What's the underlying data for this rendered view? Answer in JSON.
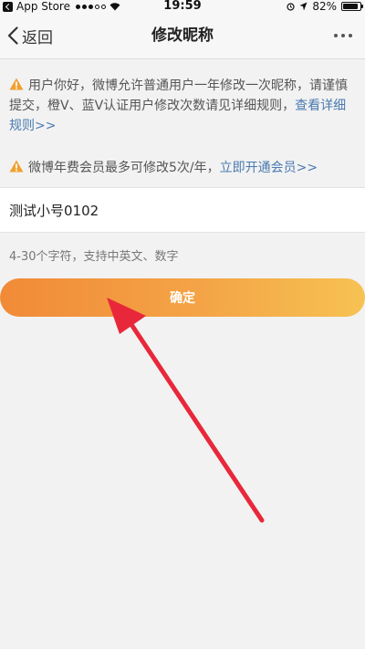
{
  "status_bar": {
    "carrier": "App Store",
    "time": "19:59",
    "battery": "82%"
  },
  "nav": {
    "back_label": "返回",
    "title": "修改昵称"
  },
  "notice": {
    "line1_text": "用户你好，微博允许普通用户一年修改一次昵称，请谨慎提交，橙V、蓝V认证用户修改次数请见详细规则，",
    "line1_link": "查看详细规则>>",
    "line2_text": "微博年费会员最多可修改5次/年，",
    "line2_link": "立即开通会员>>"
  },
  "form": {
    "nickname_value": "测试小号0102",
    "hint": "4-30个字符，支持中英文、数字",
    "confirm_label": "确定"
  },
  "colors": {
    "accent_orange": "#f4a446",
    "link_blue": "#4a7ab0",
    "warning_orange": "#f0a030",
    "annotation_red": "#e8283a"
  }
}
